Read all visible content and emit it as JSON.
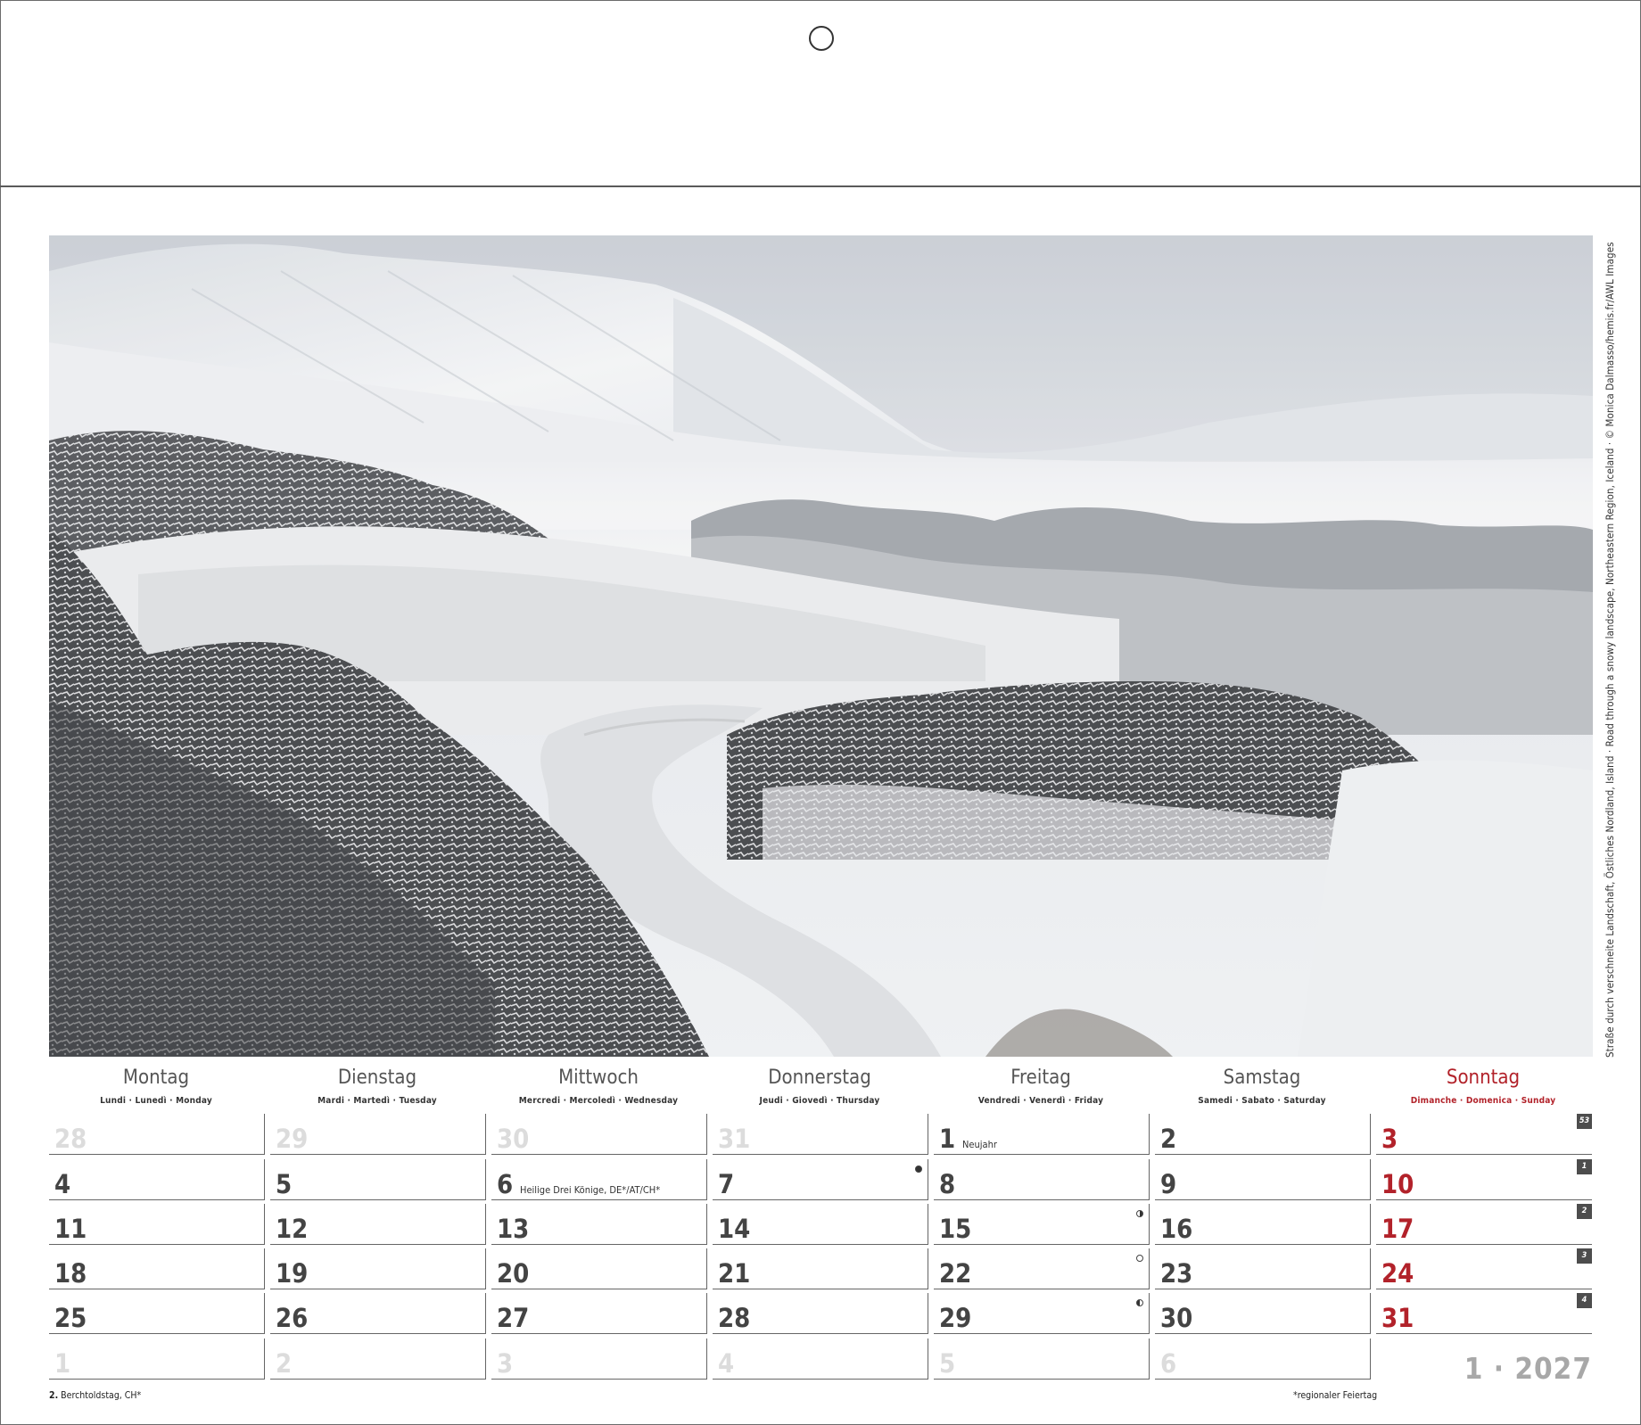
{
  "photo": {
    "credit": "Straße durch verschneite Landschaft, Östliches Nordland, Island · Road through a snowy landscape, Northeastern Region, Iceland · © Monica Dalmasso/hemis.fr/AWL Images"
  },
  "weekdays": [
    {
      "name": "Montag",
      "sub": "Lundi · Lunedì · Monday"
    },
    {
      "name": "Dienstag",
      "sub": "Mardi · Martedì · Tuesday"
    },
    {
      "name": "Mittwoch",
      "sub": "Mercredi · Mercoledì · Wednesday"
    },
    {
      "name": "Donnerstag",
      "sub": "Jeudi · Giovedì · Thursday"
    },
    {
      "name": "Freitag",
      "sub": "Vendredi · Venerdì · Friday"
    },
    {
      "name": "Samstag",
      "sub": "Samedi · Sabato · Saturday"
    },
    {
      "name": "Sonntag",
      "sub": "Dimanche · Domenica · Sunday"
    }
  ],
  "weeks": [
    {
      "badge": "53",
      "days": [
        {
          "n": "28",
          "faded": true
        },
        {
          "n": "29",
          "faded": true
        },
        {
          "n": "30",
          "faded": true
        },
        {
          "n": "31",
          "faded": true
        },
        {
          "n": "1",
          "holiday": "Neujahr"
        },
        {
          "n": "2"
        },
        {
          "n": "3"
        }
      ]
    },
    {
      "badge": "1",
      "days": [
        {
          "n": "4"
        },
        {
          "n": "5"
        },
        {
          "n": "6",
          "holiday": "Heilige Drei Könige, DE*/AT/CH*"
        },
        {
          "n": "7",
          "moon": "new"
        },
        {
          "n": "8"
        },
        {
          "n": "9"
        },
        {
          "n": "10"
        }
      ]
    },
    {
      "badge": "2",
      "days": [
        {
          "n": "11"
        },
        {
          "n": "12"
        },
        {
          "n": "13"
        },
        {
          "n": "14"
        },
        {
          "n": "15",
          "moon": "first"
        },
        {
          "n": "16"
        },
        {
          "n": "17"
        }
      ]
    },
    {
      "badge": "3",
      "days": [
        {
          "n": "18"
        },
        {
          "n": "19"
        },
        {
          "n": "20"
        },
        {
          "n": "21"
        },
        {
          "n": "22",
          "moon": "full"
        },
        {
          "n": "23"
        },
        {
          "n": "24"
        }
      ]
    },
    {
      "badge": "4",
      "days": [
        {
          "n": "25"
        },
        {
          "n": "26"
        },
        {
          "n": "27"
        },
        {
          "n": "28"
        },
        {
          "n": "29",
          "moon": "last"
        },
        {
          "n": "30"
        },
        {
          "n": "31"
        }
      ]
    },
    {
      "badge": "",
      "days": [
        {
          "n": "1",
          "faded": true
        },
        {
          "n": "2",
          "faded": true
        },
        {
          "n": "3",
          "faded": true
        },
        {
          "n": "4",
          "faded": true
        },
        {
          "n": "5",
          "faded": true
        },
        {
          "n": "6",
          "faded": true
        }
      ]
    }
  ],
  "footer": {
    "holiday_note_day": "2.",
    "holiday_note_text": "Berchtoldstag, CH*",
    "regional_note": "*regionaler Feiertag",
    "month_year": "1 · 2027"
  }
}
